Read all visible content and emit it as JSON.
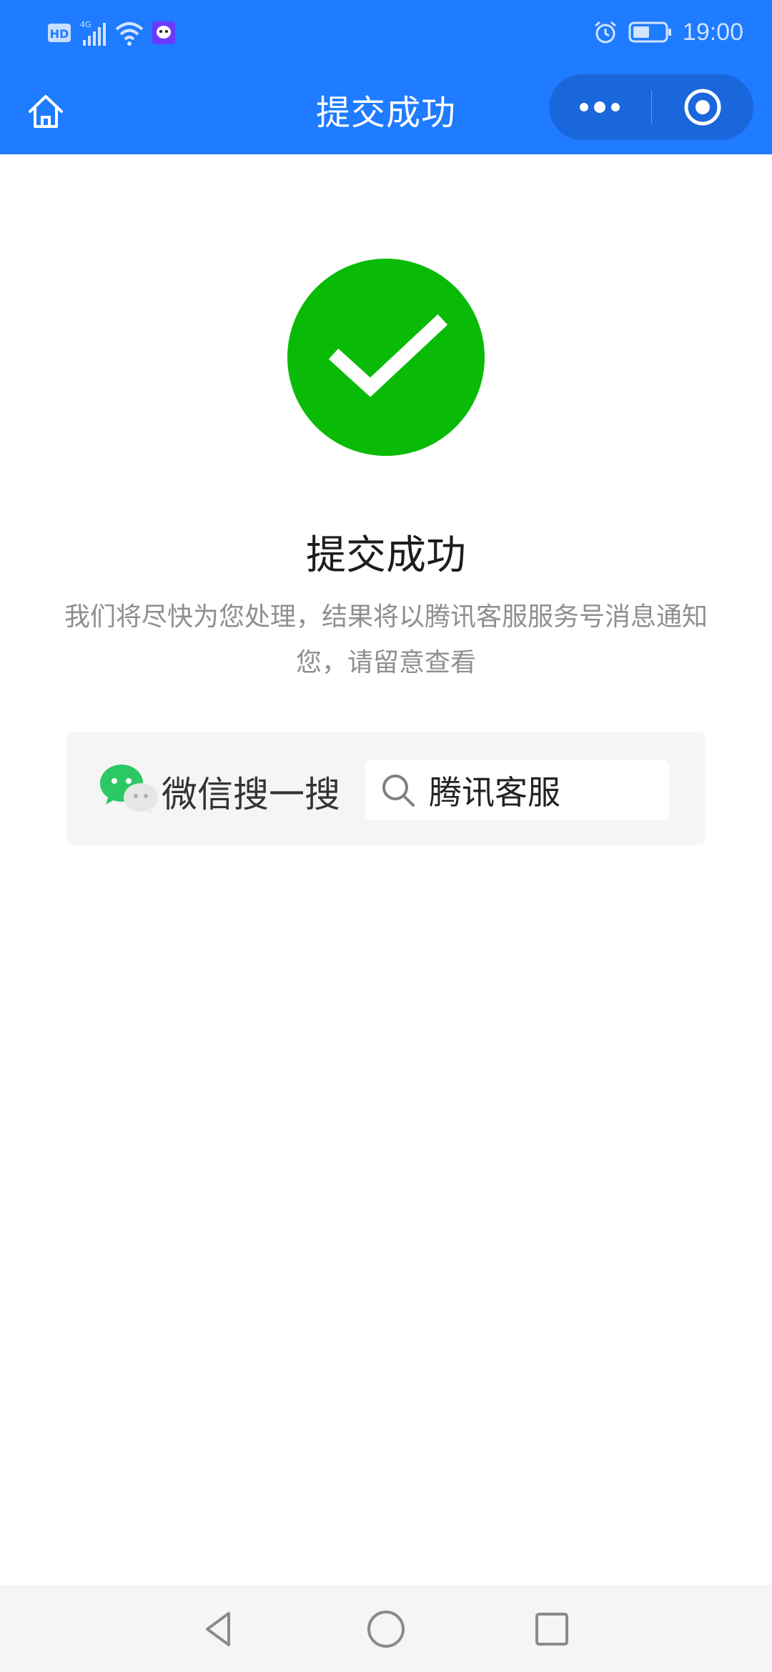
{
  "theme": {
    "brand": "#1f7bff",
    "success_green": "#09bb07"
  },
  "status_bar": {
    "time": "19:00",
    "left_indicators": [
      "HD",
      "4G"
    ]
  },
  "navbar": {
    "title": "提交成功"
  },
  "result": {
    "title": "提交成功",
    "description": "我们将尽快为您处理，结果将以腾讯客服服务号消息通知您，请留意查看"
  },
  "search_card": {
    "label": "微信搜一搜",
    "query": "腾讯客服"
  },
  "icons": {
    "home": "home-icon",
    "more": "more-dots-icon",
    "close": "target-icon",
    "success": "check-circle-icon",
    "wechat": "wechat-logo-icon",
    "search": "search-icon",
    "back": "back-triangle-icon",
    "circle": "home-circle-icon",
    "square": "recent-apps-square-icon"
  }
}
